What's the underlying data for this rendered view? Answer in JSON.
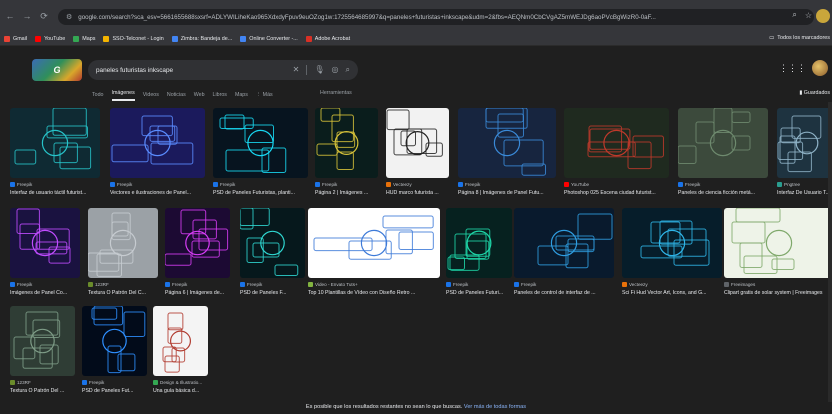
{
  "browser": {
    "url": "google.com/search?sca_esv=5661655688sxsrf=ADLYWILiheKao965XdxdyFpuv9euOZog1w:1725564685997&q=paneles+futuristas+inkscape&udm=2&fbs=AEQNm0CbCVgAZ5mWEJDg6aoPVcBgWizR0-0aF..."
  },
  "bookmarks": [
    {
      "label": "Gmail",
      "color": "#ea4335"
    },
    {
      "label": "YouTube",
      "color": "#ff0000"
    },
    {
      "label": "Maps",
      "color": "#34a853"
    },
    {
      "label": "SSO-Telconet - Login",
      "color": "#f4b400"
    },
    {
      "label": "Zimbra: Bandeja de...",
      "color": "#4285f4"
    },
    {
      "label": "Online Converter -...",
      "color": "#4285f4"
    },
    {
      "label": "Adobe Acrobat",
      "color": "#d93025"
    }
  ],
  "bookmarks_all": "Todos los marcadores",
  "search": {
    "query": "paneles futuristas inkscape"
  },
  "tabs": [
    "Todo",
    "Imágenes",
    "Videos",
    "Noticias",
    "Web",
    "Libros",
    "Maps",
    "⋮ Más"
  ],
  "active_tab": "Imágenes",
  "tools": "Herramientas",
  "saved": "Guardados",
  "results": [
    {
      "source": "Freepik",
      "title": "Interfaz de usuario táctil futurist...",
      "fav": "#1a73e8",
      "bg": "#0f2a33",
      "accent": "#27c3c9"
    },
    {
      "source": "Freepik",
      "title": "Vectores e ilustraciones de Panel...",
      "fav": "#1a73e8",
      "bg": "#1b1a5c",
      "accent": "#5a8cff"
    },
    {
      "source": "Freepik",
      "title": "PSD de Paneles Futuristas, planti...",
      "fav": "#1a73e8",
      "bg": "#07141f",
      "accent": "#18d8f2"
    },
    {
      "source": "Freepik",
      "title": "Página 2 | Imágenes ...",
      "fav": "#1a73e8",
      "bg": "#0a1d1c",
      "accent": "#d8c33a"
    },
    {
      "source": "Vecteezy",
      "title": "HUD marco futurista ...",
      "fav": "#e8710a",
      "bg": "#f2f2f2",
      "accent": "#222222"
    },
    {
      "source": "Freepik",
      "title": "Página 8 | Imágenes de Panel Futu...",
      "fav": "#1a73e8",
      "bg": "#17253f",
      "accent": "#3a8ad8"
    },
    {
      "source": "YouTube",
      "title": "Photoshop 025 Escena ciudad futurist...",
      "fav": "#ff0000",
      "bg": "#1f2a1f",
      "accent": "#c0392b"
    },
    {
      "source": "Freepik",
      "title": "Paneles de ciencia ficción metá...",
      "fav": "#1a73e8",
      "bg": "#3c4a3c",
      "accent": "#6e8a6e"
    },
    {
      "source": "Pngtree",
      "title": "Interfaz De Usuario T...",
      "fav": "#2a9d8f",
      "bg": "#1e3340",
      "accent": "#8fb3c7"
    },
    {
      "source": "Freepik",
      "title": "Imágenes de Panel Co...",
      "fav": "#1a73e8",
      "bg": "#1a1240",
      "accent": "#c04cff"
    },
    {
      "source": "123RF",
      "title": "Textura O Patrón Del C...",
      "fav": "#6a8c2b",
      "bg": "#9ba1a6",
      "accent": "#c6cbd0"
    },
    {
      "source": "Freepik",
      "title": "Página 6 | Imágenes de...",
      "fav": "#1a73e8",
      "bg": "#1c0a33",
      "accent": "#d63cf5"
    },
    {
      "source": "Freepik",
      "title": "PSD de Paneles F...",
      "fav": "#1a73e8",
      "bg": "#06181c",
      "accent": "#2fd6d0"
    },
    {
      "source": "Video - Envato Tuts+",
      "title": "Top 10 Plantillas de Vídeo con Diseño Retro ...",
      "fav": "#82b440",
      "bg": "#ffffff",
      "accent": "#3d7ad8"
    },
    {
      "source": "Freepik",
      "title": "PSD de Paneles Futuri...",
      "fav": "#1a73e8",
      "bg": "#06211f",
      "accent": "#1ed6a8"
    },
    {
      "source": "Freepik",
      "title": "Paneles de control de interfaz de ...",
      "fav": "#1a73e8",
      "bg": "#091a2d",
      "accent": "#2f9de0"
    },
    {
      "source": "Vecteezy",
      "title": "Sci Fi Hud Vector Art, Icons, and G...",
      "fav": "#e8710a",
      "bg": "#061d2a",
      "accent": "#2fb5e8"
    },
    {
      "source": "Freeimages",
      "title": "Clipart gratis de solar system | Freeimages",
      "fav": "#5f6368",
      "bg": "#eef3e8",
      "accent": "#7fa86b"
    },
    {
      "source": "123RF",
      "title": "Textura O Patrón Del ...",
      "fav": "#6a8c2b",
      "bg": "#2f3d35",
      "accent": "#7e9c87"
    },
    {
      "source": "Freepik",
      "title": "PSD de Paneles Fut...",
      "fav": "#1a73e8",
      "bg": "#020b1a",
      "accent": "#2e8fff"
    },
    {
      "source": "Design & Illustratio...",
      "title": "Una guía básica d...",
      "fav": "#34a853",
      "bg": "#f4f4f4",
      "accent": "#b03a2e"
    }
  ],
  "footer": {
    "text": "Es posible que los resultados restantes no sean lo que buscas.",
    "link": "Ver más de todas formas"
  }
}
